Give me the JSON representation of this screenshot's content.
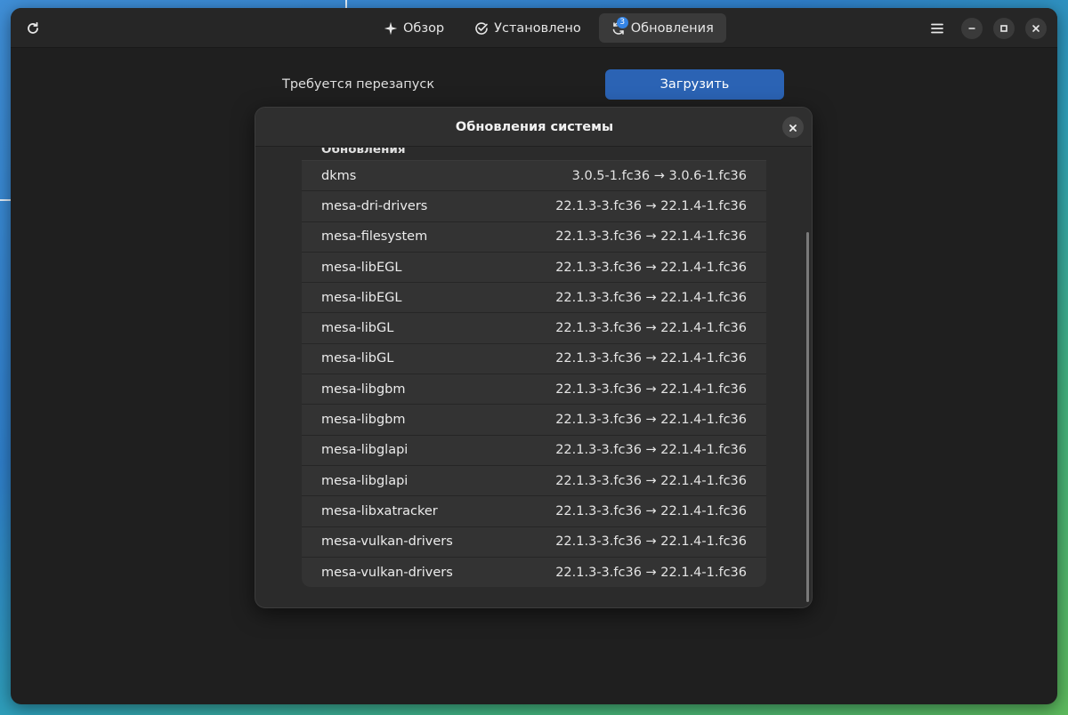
{
  "colors": {
    "accent": "#3584e4",
    "download_button": "#2b63b4",
    "window_bg": "#1f1f1f",
    "dialog_bg": "#2b2b2b"
  },
  "header": {
    "refresh_icon": "refresh-icon",
    "tabs": [
      {
        "label": "Обзор",
        "icon": "explore-icon",
        "active": false
      },
      {
        "label": "Установлено",
        "icon": "check-circle-icon",
        "active": false
      },
      {
        "label": "Обновления",
        "icon": "updates-icon",
        "active": true,
        "badge": "3"
      }
    ],
    "menu_icon": "hamburger-menu-icon",
    "window_controls": [
      "minimize-icon",
      "maximize-icon",
      "close-icon"
    ]
  },
  "main": {
    "restart_label": "Требуется перезапуск",
    "download_label": "Загрузить"
  },
  "dialog": {
    "title": "Обновления системы",
    "section_heading": "Обновления",
    "packages": [
      {
        "name": "dkms",
        "version": "3.0.5-1.fc36 → 3.0.6-1.fc36"
      },
      {
        "name": "mesa-dri-drivers",
        "version": "22.1.3-3.fc36 → 22.1.4-1.fc36"
      },
      {
        "name": "mesa-filesystem",
        "version": "22.1.3-3.fc36 → 22.1.4-1.fc36"
      },
      {
        "name": "mesa-libEGL",
        "version": "22.1.3-3.fc36 → 22.1.4-1.fc36"
      },
      {
        "name": "mesa-libEGL",
        "version": "22.1.3-3.fc36 → 22.1.4-1.fc36"
      },
      {
        "name": "mesa-libGL",
        "version": "22.1.3-3.fc36 → 22.1.4-1.fc36"
      },
      {
        "name": "mesa-libGL",
        "version": "22.1.3-3.fc36 → 22.1.4-1.fc36"
      },
      {
        "name": "mesa-libgbm",
        "version": "22.1.3-3.fc36 → 22.1.4-1.fc36"
      },
      {
        "name": "mesa-libgbm",
        "version": "22.1.3-3.fc36 → 22.1.4-1.fc36"
      },
      {
        "name": "mesa-libglapi",
        "version": "22.1.3-3.fc36 → 22.1.4-1.fc36"
      },
      {
        "name": "mesa-libglapi",
        "version": "22.1.3-3.fc36 → 22.1.4-1.fc36"
      },
      {
        "name": "mesa-libxatracker",
        "version": "22.1.3-3.fc36 → 22.1.4-1.fc36"
      },
      {
        "name": "mesa-vulkan-drivers",
        "version": "22.1.3-3.fc36 → 22.1.4-1.fc36"
      },
      {
        "name": "mesa-vulkan-drivers",
        "version": "22.1.3-3.fc36 → 22.1.4-1.fc36"
      }
    ]
  }
}
